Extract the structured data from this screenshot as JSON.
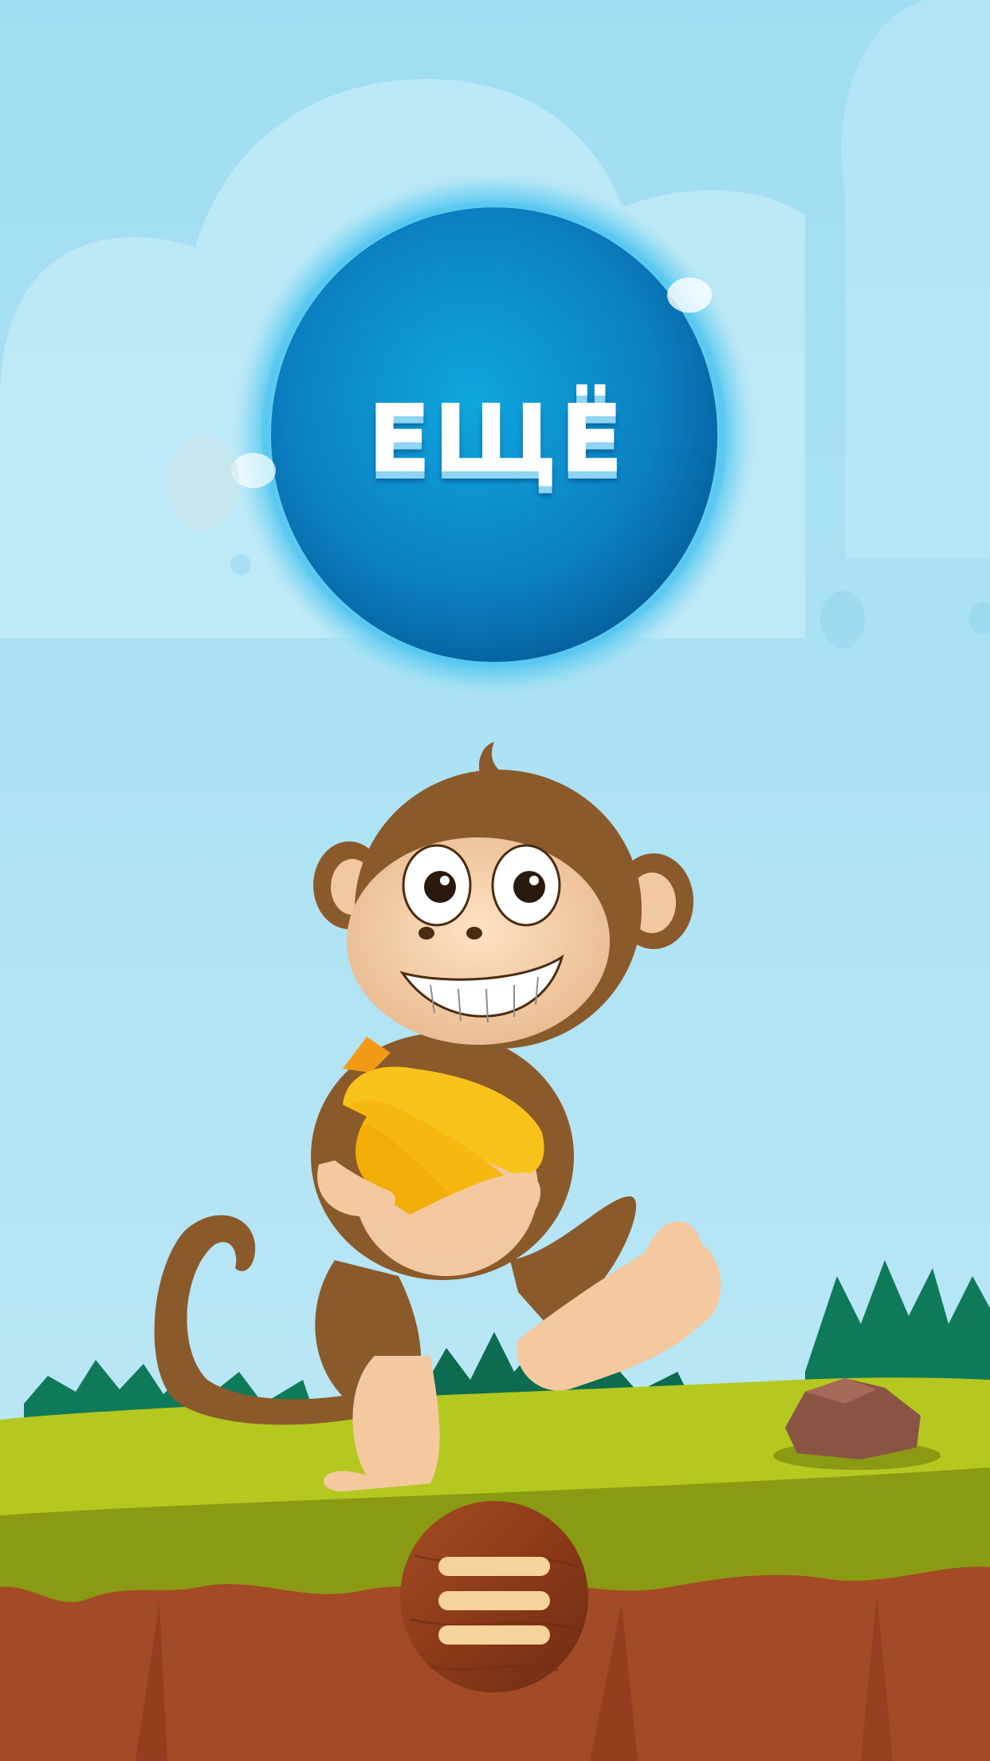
{
  "screen": {
    "name": "game-start-screen"
  },
  "more_button": {
    "label": "ЕЩЁ"
  },
  "menu_button": {
    "icon": "hamburger-menu-icon"
  },
  "colors": {
    "sky_top": "#9fdef2",
    "sky_bottom": "#bde8f6",
    "orb_blue": "#0a7fc4",
    "orb_glow": "#4cc3ef",
    "grass": "#b5c81f",
    "grass_dark": "#8a9a12",
    "soil": "#a34a26",
    "monkey_brown": "#8b5a2b",
    "banana_yellow": "#f7c31a"
  }
}
